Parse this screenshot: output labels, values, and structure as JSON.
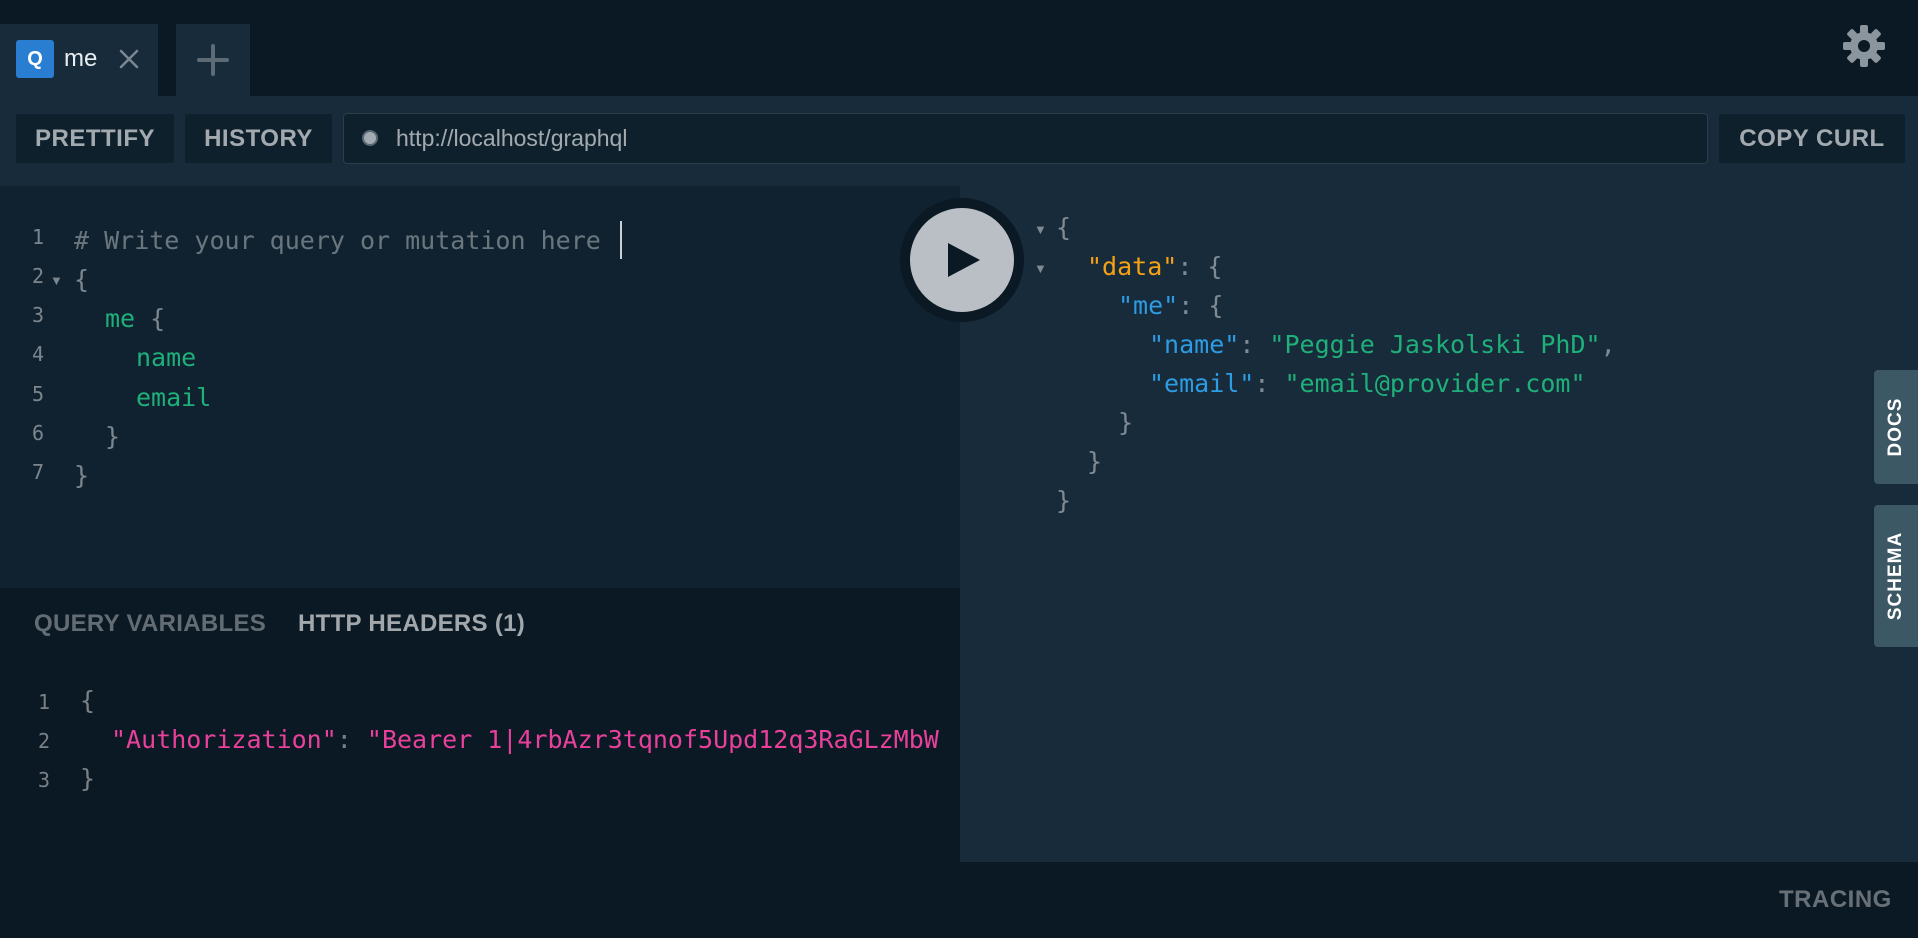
{
  "tabs": [
    {
      "badge": "Q",
      "title": "me"
    }
  ],
  "toolbar": {
    "prettify_label": "PRETTIFY",
    "history_label": "HISTORY",
    "endpoint_url": "http://localhost/graphql",
    "copy_curl_label": "COPY CURL"
  },
  "editor": {
    "line_numbers": [
      "1",
      "2",
      "3",
      "4",
      "5",
      "6",
      "7"
    ],
    "comment": "# Write your query or mutation here",
    "open_brace": "{",
    "field_me": "me",
    "field_me_brace": " {",
    "field_name": "name",
    "field_email": "email",
    "close_inner": "}",
    "close_outer": "}"
  },
  "variables_panel": {
    "query_variables_tab": "QUERY VARIABLES",
    "http_headers_tab": "HTTP HEADERS (1)",
    "line_numbers": [
      "1",
      "2",
      "3"
    ],
    "open_brace": "{",
    "header_key": "\"Authorization\"",
    "colon": ": ",
    "header_value": "\"Bearer 1|4rbAzr3tqnof5Upd12q3RaGLzMbW",
    "close_brace": "}"
  },
  "result": {
    "open_brace": "{",
    "data_key": "\"data\"",
    "me_key": "\"me\"",
    "name_key": "\"name\"",
    "name_value": "\"Peggie Jaskolski PhD\"",
    "email_key": "\"email\"",
    "email_value": "\"email@provider.com\"",
    "colon": ": ",
    "brace_open": "{",
    "comma": ",",
    "close_brace": "}"
  },
  "side_tabs": {
    "docs": "DOCS",
    "schema": "SCHEMA"
  },
  "footer": {
    "tracing": "TRACING"
  },
  "icons": {
    "tab_close": "close-icon",
    "tab_add": "plus-icon",
    "settings": "gear-icon",
    "play": "play-icon",
    "endpoint_status": "status-dot-icon"
  },
  "colors": {
    "field_green": "#1fb07a",
    "key_blue": "#2e9ce3",
    "data_orange": "#f5a214",
    "header_pink": "#e8409b",
    "badge_blue": "#2a7ed2"
  }
}
